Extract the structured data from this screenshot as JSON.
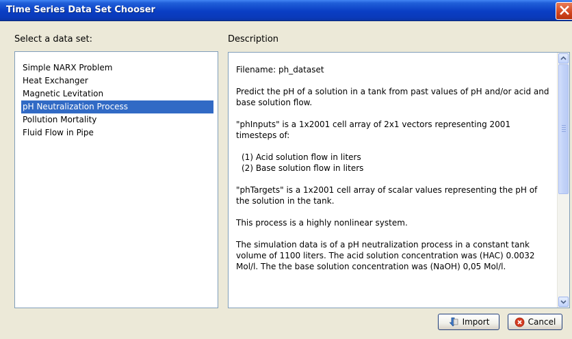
{
  "window": {
    "title": "Time Series Data Set Chooser"
  },
  "list": {
    "label": "Select a data set:",
    "items": [
      "Simple NARX Problem",
      "Heat Exchanger",
      "Magnetic Levitation",
      "pH Neutralization Process",
      "Pollution Mortality",
      "Fluid Flow in Pipe"
    ],
    "selected_index": 3
  },
  "description": {
    "label": "Description",
    "filename": "Filename: ph_dataset",
    "p1": "Predict the pH of a solution in a tank from past values of pH and/or acid and base solution flow.",
    "p2": "\"phInputs\" is a 1x2001 cell array of 2x1 vectors representing 2001 timesteps of:",
    "item1": "(1) Acid solution flow in liters",
    "item2": "(2) Base solution flow in liters",
    "p3": "\"phTargets\" is a 1x2001 cell array of scalar values representing the pH of the solution in the tank.",
    "p4": "This process is a highly nonlinear system.",
    "p5": "The simulation data is of a pH neutralization process in a constant tank volume of 1100 liters. The acid solution concentration was (HAC) 0.0032 Mol/l. The the base solution concentration was (NaOH) 0,05 Mol/l."
  },
  "buttons": {
    "import": "Import",
    "cancel": "Cancel"
  },
  "icons": {
    "close": "close-icon",
    "import": "import-icon",
    "cancel": "cancel-icon"
  },
  "colors": {
    "selection": "#316ac5",
    "titlebar": "#0a3ec4"
  }
}
